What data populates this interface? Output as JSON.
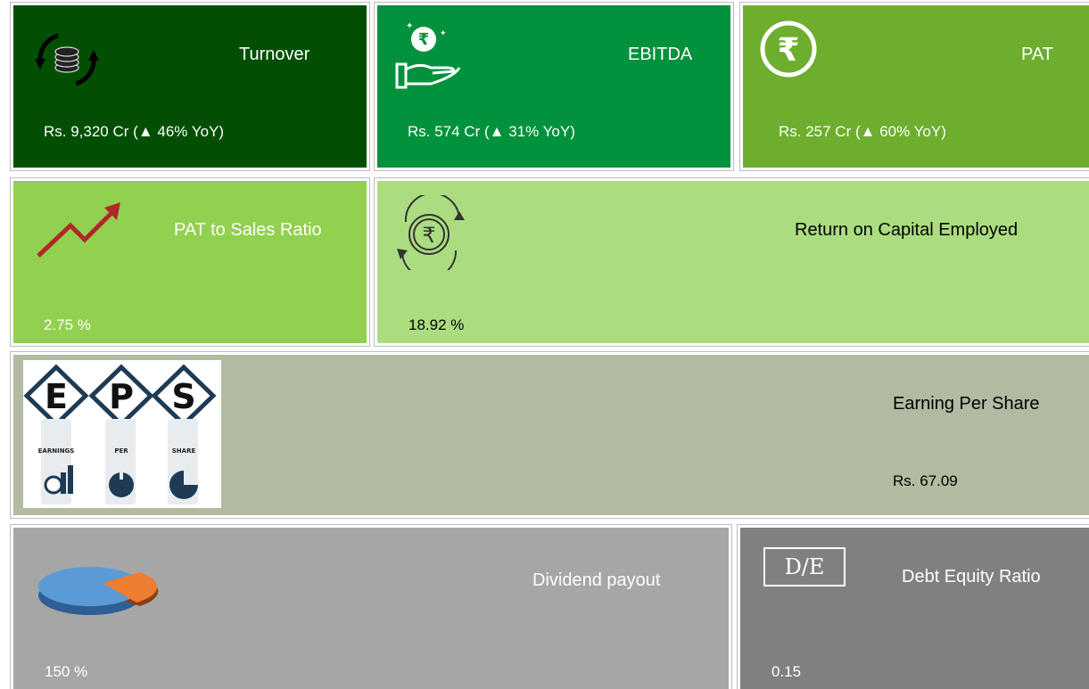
{
  "tiles": {
    "turnover": {
      "title": "Turnover",
      "value_prefix": "Rs. 9,320 Cr (",
      "arrow": "▲",
      "value_suffix": " 46% YoY)",
      "icon": "coins-exchange-icon",
      "bg": "#024F04"
    },
    "ebitda": {
      "title": "EBITDA",
      "value_prefix": "Rs. 574 Cr (",
      "arrow": "▲",
      "value_suffix": " 31% YoY)",
      "icon": "hand-rupee-coin-icon",
      "bg": "#02923D"
    },
    "pat": {
      "title": "PAT",
      "value_prefix": "Rs. 257 Cr (",
      "arrow": "▲",
      "value_suffix": " 60% YoY)",
      "icon": "rupee-circle-icon",
      "bg": "#6DAE2F"
    },
    "pat_to_sales": {
      "title": "PAT to Sales Ratio",
      "value": "2.75 %",
      "icon": "trend-up-arrow-icon",
      "bg": "#92D050"
    },
    "roce": {
      "title": "Return on Capital Employed",
      "value": "18.92 %",
      "icon": "rupee-cycle-icon",
      "bg": "#ABDD80"
    },
    "eps": {
      "title": "Earning Per Share",
      "value": "Rs. 67.09",
      "icon": "eps-logo-icon",
      "logo_letters": [
        "E",
        "P",
        "S"
      ],
      "logo_words": [
        "EARNINGS",
        "PER",
        "SHARE"
      ],
      "bg": "#B1BBA1"
    },
    "dividend": {
      "title": "Dividend payout",
      "value": "150 %",
      "icon": "pie-chart-icon",
      "bg": "#A6A6A6"
    },
    "debt_equity": {
      "title": "Debt Equity Ratio",
      "value": "0.15",
      "icon_text": "D/E",
      "icon": "de-box-icon",
      "bg": "#808080"
    }
  }
}
